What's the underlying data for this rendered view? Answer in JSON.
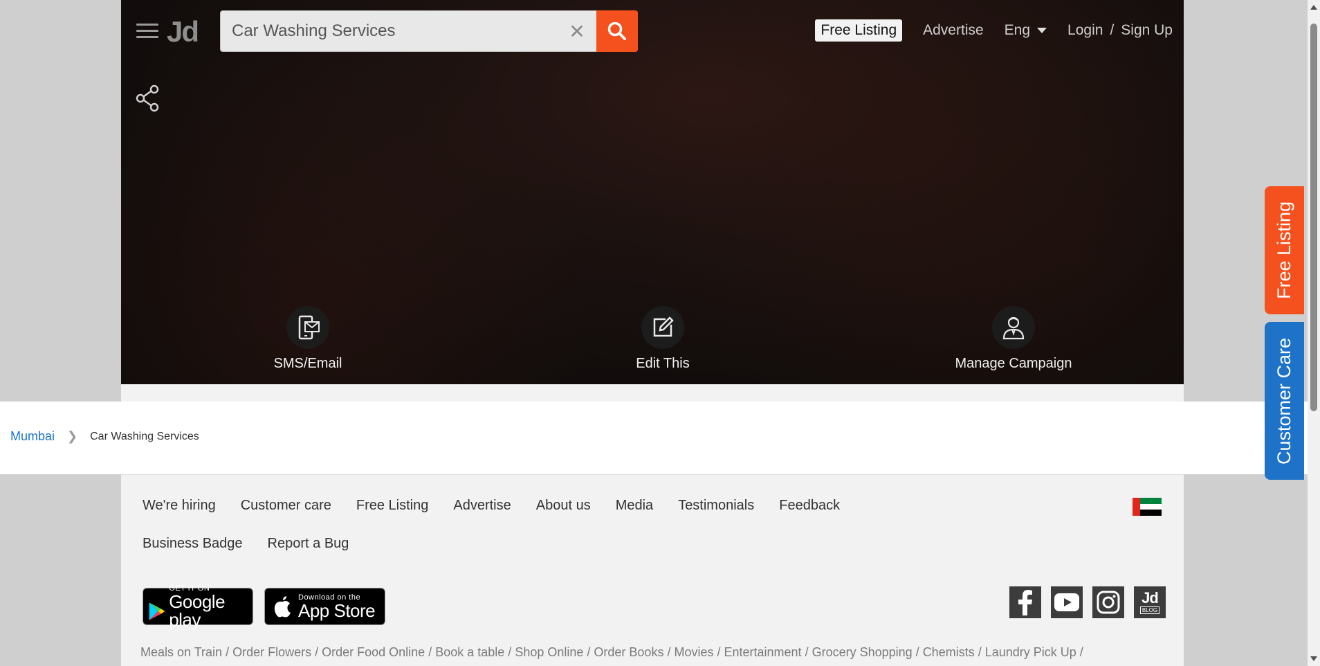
{
  "header": {
    "logo_text": "Jd",
    "search_value": "Car Washing Services",
    "free_listing": "Free Listing",
    "advertise": "Advertise",
    "language": "Eng",
    "login": "Login",
    "auth_separator": "/",
    "signup": "Sign Up"
  },
  "hero": {
    "actions": [
      {
        "label": "SMS/Email",
        "icon": "sms-email-icon"
      },
      {
        "label": "Edit This",
        "icon": "edit-icon"
      },
      {
        "label": "Manage Campaign",
        "icon": "manage-campaign-icon"
      }
    ]
  },
  "breadcrumb": {
    "city": "Mumbai",
    "separator": "❯",
    "current": "Car Washing Services"
  },
  "footer": {
    "links": [
      "We're hiring",
      "Customer care",
      "Free Listing",
      "Advertise",
      "About us",
      "Media",
      "Testimonials",
      "Feedback",
      "Business Badge",
      "Report a Bug"
    ],
    "google_play": {
      "small": "GET IT ON",
      "big": "Google play"
    },
    "app_store": {
      "small": "Download on the",
      "big": "App Store"
    },
    "social": [
      "facebook-icon",
      "youtube-icon",
      "instagram-icon",
      "jd-blog-icon"
    ],
    "jd_blog_label": "BLOG",
    "quick_links": [
      "Meals on Train",
      "Order Flowers",
      "Order Food Online",
      "Book a table",
      "Shop Online",
      "Order Books",
      "Movies",
      "Entertainment",
      "Grocery Shopping",
      "Chemists",
      "Laundry Pick Up"
    ],
    "quick_sep": "/"
  },
  "side_tabs": {
    "free_listing": "Free Listing",
    "customer_care": "Customer Care"
  },
  "colors": {
    "accent_orange": "#f4511e",
    "customer_care_blue": "#1e73c9",
    "link_blue": "#1a73c8"
  }
}
